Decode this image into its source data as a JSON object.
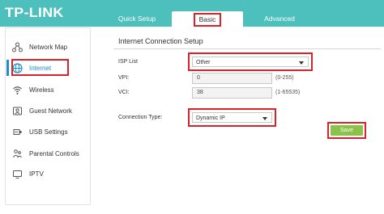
{
  "brand": {
    "logo_text": "TP-LINK",
    "header_color": "#4dbfbd",
    "highlight_color": "#d9222a",
    "save_color": "#8bc34a",
    "active_color": "#1a8fcc"
  },
  "tabs": [
    {
      "label": "Quick Setup",
      "active": false
    },
    {
      "label": "Basic",
      "active": true
    },
    {
      "label": "Advanced",
      "active": false
    }
  ],
  "sidebar": {
    "items": [
      {
        "label": "Network Map",
        "icon": "network-map-icon",
        "active": false
      },
      {
        "label": "Internet",
        "icon": "globe-icon",
        "active": true
      },
      {
        "label": "Wireless",
        "icon": "wireless-icon",
        "active": false
      },
      {
        "label": "Guest Network",
        "icon": "guest-network-icon",
        "active": false
      },
      {
        "label": "USB Settings",
        "icon": "usb-icon",
        "active": false
      },
      {
        "label": "Parental Controls",
        "icon": "parental-controls-icon",
        "active": false
      },
      {
        "label": "IPTV",
        "icon": "iptv-icon",
        "active": false
      }
    ]
  },
  "main": {
    "section_title": "Internet Connection Setup",
    "isp_list": {
      "label": "ISP List",
      "value": "Other"
    },
    "vpi": {
      "label": "VPI:",
      "value": "0",
      "hint": "(0-255)"
    },
    "vci": {
      "label": "VCI:",
      "value": "38",
      "hint": "(1-65535)"
    },
    "connection_type": {
      "label": "Connection Type:",
      "value": "Dynamic IP"
    },
    "save_label": "Save"
  }
}
